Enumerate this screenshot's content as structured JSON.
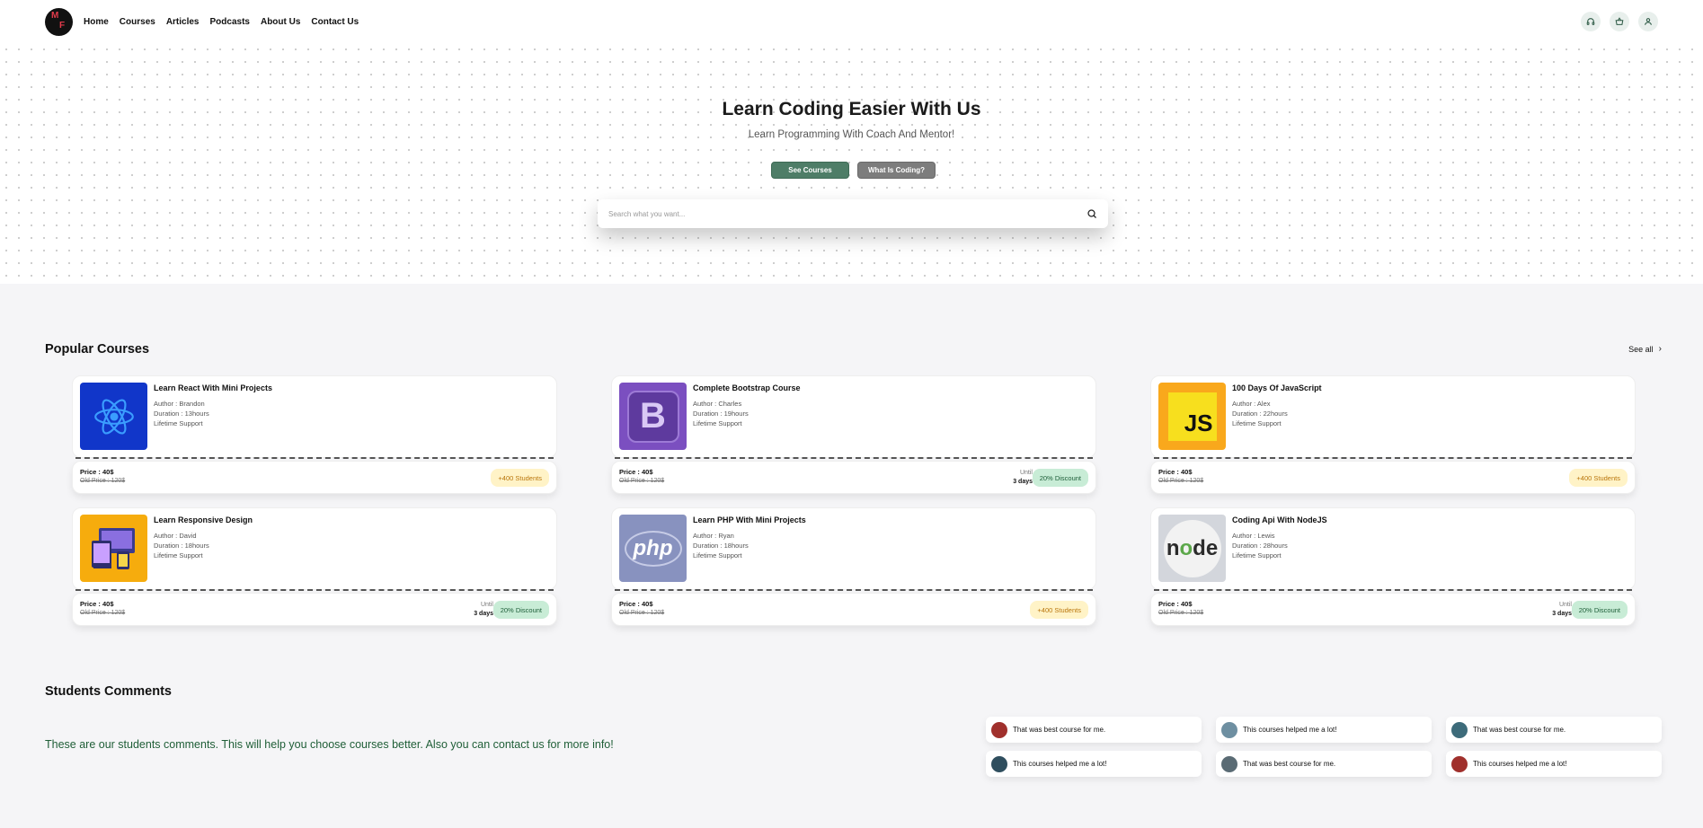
{
  "header": {
    "logo_m": "M",
    "logo_f": "F",
    "nav": [
      "Home",
      "Courses",
      "Articles",
      "Podcasts",
      "About Us",
      "Contact Us"
    ]
  },
  "hero": {
    "title": "Learn Coding Easier With Us",
    "subtitle": "Learn Programming With Coach And Mentor!",
    "primary_button": "See Courses",
    "secondary_button": "What Is Coding?",
    "search_placeholder": "Search what you want..."
  },
  "popular": {
    "title": "Popular Courses",
    "see_all": "See all",
    "courses": [
      {
        "title": "Learn React With Mini Projects",
        "author": "Author : Brandon",
        "duration": "Duration : 13hours",
        "support": "Lifetime Support",
        "price": "Price : 40$",
        "old_price": "Old Price : 120$",
        "badge": "+400 Students",
        "badge_type": "students",
        "icon": "react-icon",
        "thumb_color": "#1136c9"
      },
      {
        "title": "Complete Bootstrap Course",
        "author": "Author : Charles",
        "duration": "Duration : 19hours",
        "support": "Lifetime Support",
        "price": "Price : 40$",
        "old_price": "Old Price : 120$",
        "badge": "20% Discount",
        "badge_type": "discount",
        "until_label": "Until",
        "until_value": "3 days",
        "icon": "bootstrap-icon",
        "thumb_color": "#7b4fc0"
      },
      {
        "title": "100 Days Of JavaScript",
        "author": "Author : Alex",
        "duration": "Duration : 22hours",
        "support": "Lifetime Support",
        "price": "Price : 40$",
        "old_price": "Old Price : 120$",
        "badge": "+400 Students",
        "badge_type": "students",
        "icon": "javascript-icon",
        "thumb_color": "#f9a81c"
      },
      {
        "title": "Learn Responsive Design",
        "author": "Author : David",
        "duration": "Duration : 18hours",
        "support": "Lifetime Support",
        "price": "Price : 40$",
        "old_price": "Old Price : 120$",
        "badge": "20% Discount",
        "badge_type": "discount",
        "until_label": "Until",
        "until_value": "3 days",
        "icon": "responsive-icon",
        "thumb_color": "#f6ac0d"
      },
      {
        "title": "Learn PHP With Mini Projects",
        "author": "Author : Ryan",
        "duration": "Duration : 18hours",
        "support": "Lifetime Support",
        "price": "Price : 40$",
        "old_price": "Old Price : 120$",
        "badge": "+400 Students",
        "badge_type": "students",
        "icon": "php-icon",
        "thumb_color": "#8892bf"
      },
      {
        "title": "Coding Api With NodeJS",
        "author": "Author : Lewis",
        "duration": "Duration : 28hours",
        "support": "Lifetime Support",
        "price": "Price : 40$",
        "old_price": "Old Price : 120$",
        "badge": "20% Discount",
        "badge_type": "discount",
        "until_label": "Until",
        "until_value": "3 days",
        "icon": "nodejs-icon",
        "thumb_color": "#d3d6dc"
      }
    ]
  },
  "comments": {
    "title": "Students Comments",
    "text": "These are our students comments. This will help you choose courses better. Also you can contact us for more info!",
    "items": [
      {
        "text": "That was best course for me.",
        "avatar_color": "#a0302c"
      },
      {
        "text": "This courses helped me a lot!",
        "avatar_color": "#6e8fa1"
      },
      {
        "text": "That was best course for me.",
        "avatar_color": "#3d6b7a"
      },
      {
        "text": "This courses helped me a lot!",
        "avatar_color": "#2f4e5e"
      },
      {
        "text": "That was best course for me.",
        "avatar_color": "#5a6b74"
      },
      {
        "text": "This courses helped me a lot!",
        "avatar_color": "#a0302c"
      }
    ]
  },
  "colors": {
    "brand_green": "#4e7d67",
    "accent_red": "#e23b4b",
    "comment_text": "#1f5e37"
  }
}
